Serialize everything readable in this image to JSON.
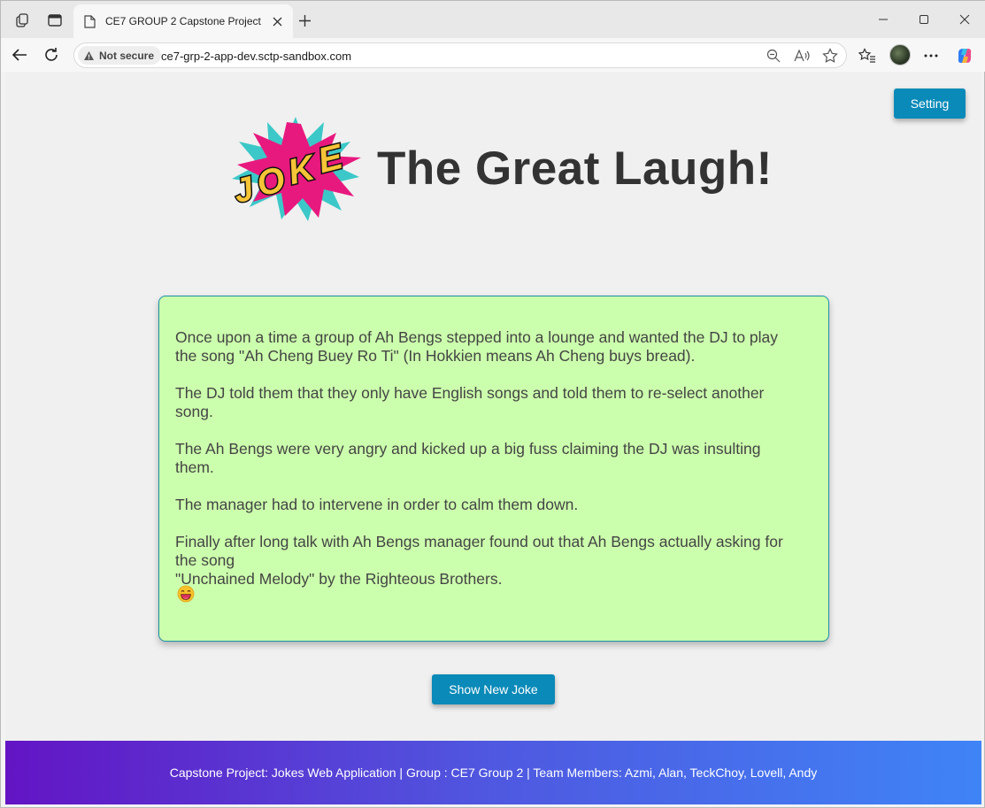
{
  "browser": {
    "tab_title": "CE7 GROUP 2 Capstone Project",
    "security_label": "Not secure",
    "url": "ce7-grp-2-app-dev.sctp-sandbox.com"
  },
  "header": {
    "setting_label": "Setting",
    "logo_text": "JOKE",
    "title": "The Great Laugh!"
  },
  "joke": {
    "paragraphs": [
      [
        "Once upon a time a group of Ah Bengs stepped into a lounge and wanted the DJ to play",
        "the song \"Ah Cheng Buey Ro Ti\" (In Hokkien means Ah Cheng buys bread)."
      ],
      [
        "The DJ told them that they only have English songs and told them to re-select another",
        "song."
      ],
      [
        "The Ah Bengs were very angry and kicked up a big fuss claiming the DJ was insulting",
        "them."
      ],
      [
        "The manager had to intervene in order to calm them down."
      ],
      [
        "Finally after long talk with Ah Bengs manager found out that Ah Bengs actually asking for",
        "the song",
        "\"Unchained Melody\" by the Righteous Brothers."
      ]
    ],
    "emoji": "laughing-face-emoji"
  },
  "actions": {
    "new_joke_label": "Show New Joke"
  },
  "footer": {
    "text": "Capstone Project: Jokes Web Application | Group : CE7 Group 2 | Team Members: Azmi, Alan, TeckChoy, Lovell, Andy"
  },
  "colors": {
    "button": "#0a8ab8",
    "joke_box_bg": "#ccffad",
    "joke_box_border": "#1a8fa5",
    "footer_start": "#6314c4",
    "footer_end": "#3f84f7",
    "title": "#333333"
  }
}
